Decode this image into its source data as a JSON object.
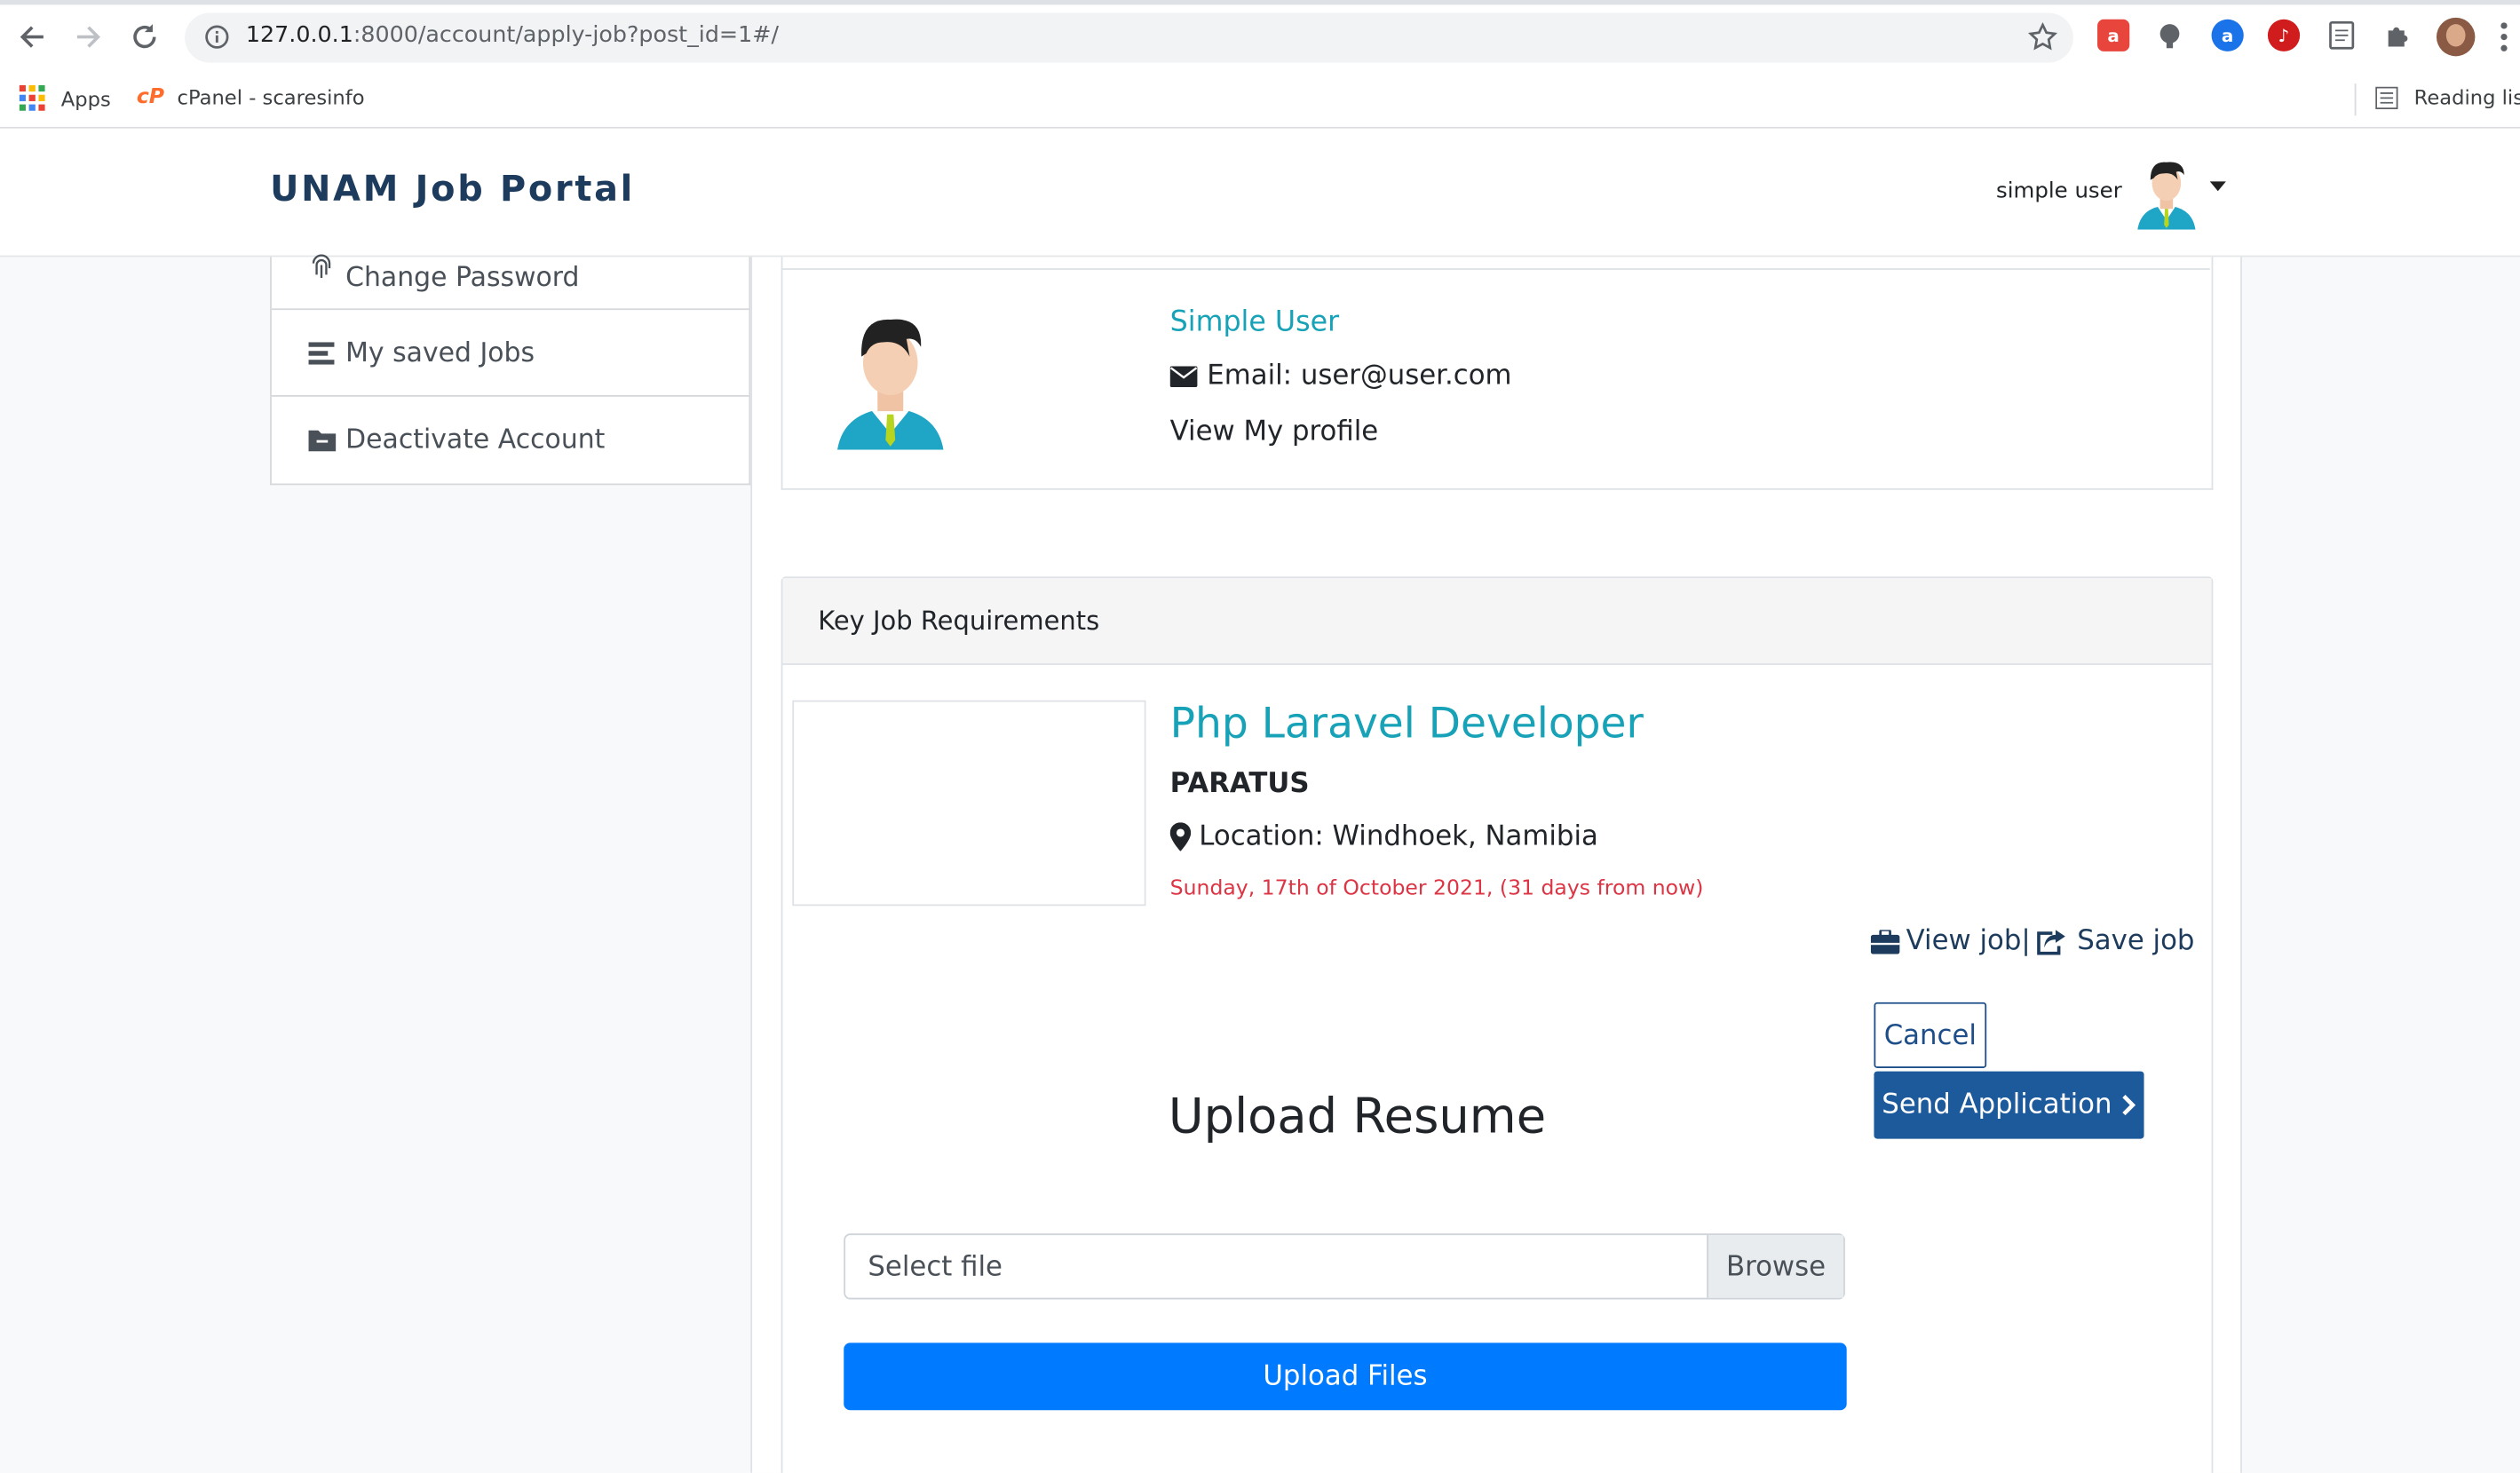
{
  "browser": {
    "url": "127.0.0.1:8000/account/apply-job?post_id=1#/",
    "url_host": "127.0.0.1",
    "url_rest": ":8000/account/apply-job?post_id=1#/",
    "bookmarks": [
      {
        "label": "Apps",
        "icon": "apps-grid-icon"
      },
      {
        "label": "cPanel - scaresinfo",
        "icon": "cpanel-icon"
      }
    ],
    "reading_list": "Reading list"
  },
  "header": {
    "brand": "UNAM Job Portal",
    "user_name": "simple user"
  },
  "sidebar": {
    "items": [
      {
        "label": "Change Password",
        "icon": "fingerprint-icon"
      },
      {
        "label": "My saved Jobs",
        "icon": "list-icon"
      },
      {
        "label": "Deactivate Account",
        "icon": "folder-icon"
      }
    ]
  },
  "profile": {
    "name": "Simple User",
    "email": "Email: user@user.com",
    "view_profile": "View My profile"
  },
  "job": {
    "section_title": "Key Job Requirements",
    "title": "Php Laravel Developer",
    "company": "PARATUS",
    "location": "Location: Windhoek, Namibia",
    "deadline": "Sunday, 17th of October 2021, (31 days from now)",
    "view_job": "View job|",
    "save_job": "Save job",
    "cancel": "Cancel",
    "send_application": "Send Application"
  },
  "upload": {
    "heading": "Upload Resume",
    "placeholder": "Select file",
    "browse": "Browse",
    "upload_button": "Upload Files"
  },
  "colors": {
    "brand": "#1d3b5c",
    "teal": "#17a2b8",
    "primary": "#007bff",
    "deadline": "#dc3545",
    "send_button": "#1d5a9b"
  }
}
